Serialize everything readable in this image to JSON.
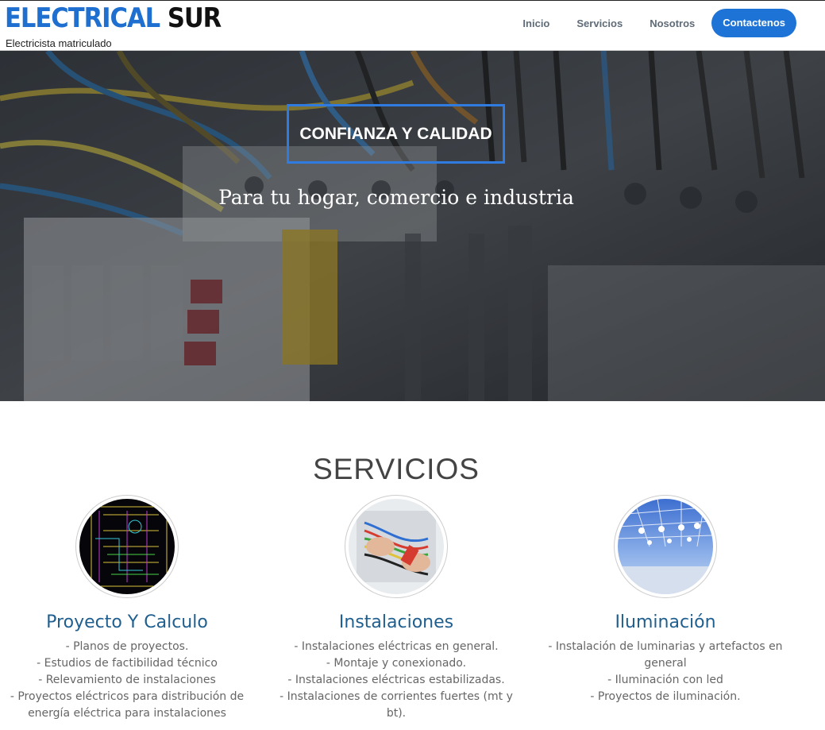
{
  "header": {
    "logo_part1": "ELECTRICAL",
    "logo_part2": "SUR",
    "tagline": "Electricista matriculado",
    "nav": [
      "Inicio",
      "Servicios",
      "Nosotros"
    ],
    "cta": "Contactenos"
  },
  "hero": {
    "title": "CONFIANZA Y CALIDAD",
    "subtitle": "Para tu hogar, comercio e industria"
  },
  "services": {
    "title": "SERVICIOS",
    "items": [
      {
        "title": "Proyecto Y Calculo",
        "lines": [
          "- Planos de proyectos.",
          "- Estudios de factibilidad técnico",
          "- Relevamiento de instalaciones",
          "- Proyectos eléctricos para distribución de",
          "energía eléctrica para instalaciones"
        ]
      },
      {
        "title": "Instalaciones",
        "lines": [
          "- Instalaciones eléctricas en general.",
          "- Montaje y conexionado.",
          "- Instalaciones eléctricas estabilizadas.",
          "- Instalaciones de corrientes fuertes (mt y",
          "bt)."
        ]
      },
      {
        "title": "Iluminación",
        "lines": [
          "- Instalación de luminarias y artefactos en",
          "general",
          "- Iluminación con led",
          "- Proyectos de iluminación."
        ]
      }
    ]
  },
  "colors": {
    "accent": "#1e73d6",
    "logo_blue": "#1e6fd0",
    "service_title": "#1f5f8f"
  }
}
